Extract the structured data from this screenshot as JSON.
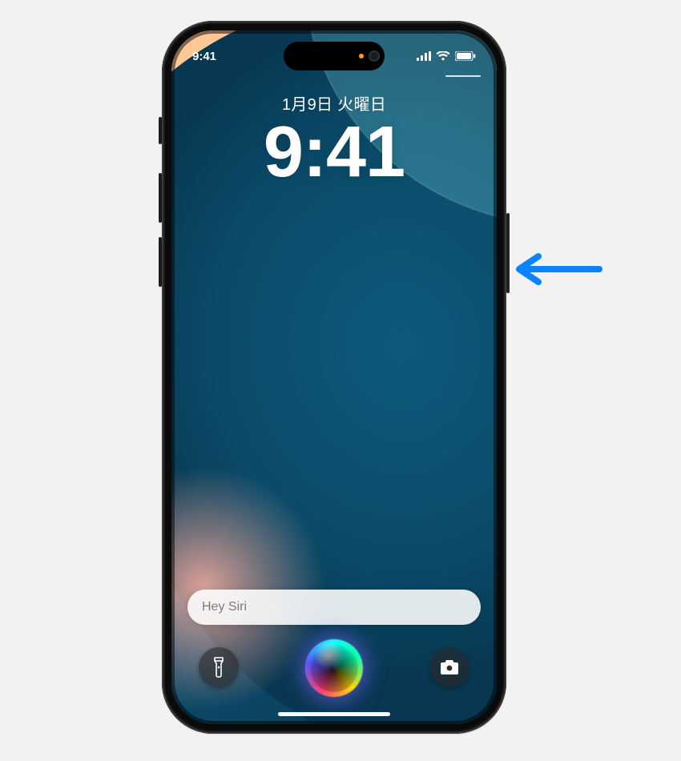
{
  "statusbar": {
    "time": "9:41",
    "icons": {
      "signal": "signal-icon",
      "wifi": "wifi-icon",
      "battery": "battery-icon"
    }
  },
  "lockscreen": {
    "date": "1月9日 火曜日",
    "time": "9:41"
  },
  "siri": {
    "prompt": "Hey Siri"
  },
  "shortcuts": {
    "left": "flashlight-icon",
    "right": "camera-icon"
  },
  "annotation": {
    "arrow_target": "side-button"
  },
  "colors": {
    "arrow": "#0a84ff",
    "page_bg": "#f2f2f2",
    "frame": "#0a0a0a"
  }
}
